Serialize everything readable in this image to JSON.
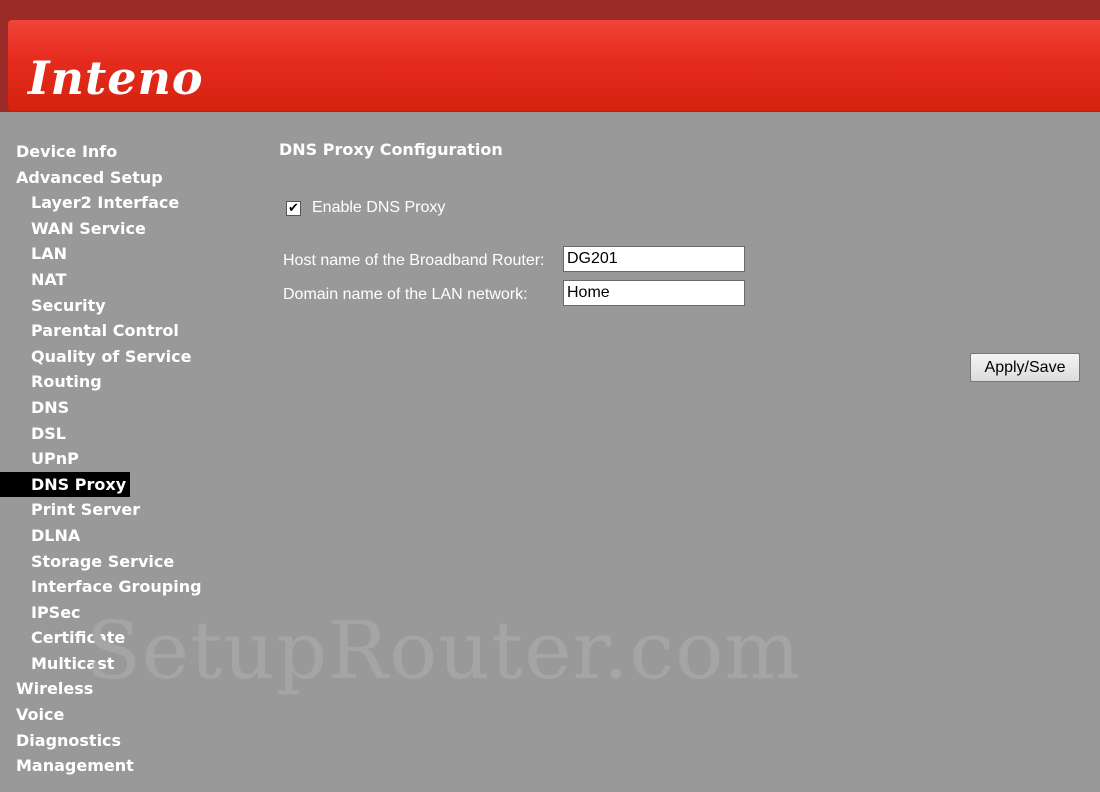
{
  "header": {
    "logo_text": "Inteno",
    "colors": {
      "frame": "#9a2b27",
      "banner": "#e52b1d"
    }
  },
  "sidebar": {
    "items": [
      {
        "label": "Device Info",
        "level": "top"
      },
      {
        "label": "Advanced Setup",
        "level": "top"
      },
      {
        "label": "Layer2 Interface",
        "level": "sub"
      },
      {
        "label": "WAN Service",
        "level": "sub"
      },
      {
        "label": "LAN",
        "level": "sub"
      },
      {
        "label": "NAT",
        "level": "sub"
      },
      {
        "label": "Security",
        "level": "sub"
      },
      {
        "label": "Parental Control",
        "level": "sub"
      },
      {
        "label": "Quality of Service",
        "level": "sub"
      },
      {
        "label": "Routing",
        "level": "sub"
      },
      {
        "label": "DNS",
        "level": "sub"
      },
      {
        "label": "DSL",
        "level": "sub"
      },
      {
        "label": "UPnP",
        "level": "sub"
      },
      {
        "label": "DNS Proxy",
        "level": "sub",
        "active": true
      },
      {
        "label": "Print Server",
        "level": "sub"
      },
      {
        "label": "DLNA",
        "level": "sub"
      },
      {
        "label": "Storage Service",
        "level": "sub"
      },
      {
        "label": "Interface Grouping",
        "level": "sub"
      },
      {
        "label": "IPSec",
        "level": "sub"
      },
      {
        "label": "Certificate",
        "level": "sub"
      },
      {
        "label": "Multicast",
        "level": "sub"
      },
      {
        "label": "Wireless",
        "level": "top"
      },
      {
        "label": "Voice",
        "level": "top"
      },
      {
        "label": "Diagnostics",
        "level": "top"
      },
      {
        "label": "Management",
        "level": "top"
      }
    ]
  },
  "main": {
    "title": "DNS Proxy Configuration",
    "enable_label": "Enable DNS Proxy",
    "enable_checked": true,
    "host_label": "Host name of the Broadband Router:",
    "host_value": "DG201",
    "domain_label": "Domain name of the LAN network:",
    "domain_value": "Home",
    "apply_label": "Apply/Save"
  },
  "watermark": "SetupRouter.com"
}
